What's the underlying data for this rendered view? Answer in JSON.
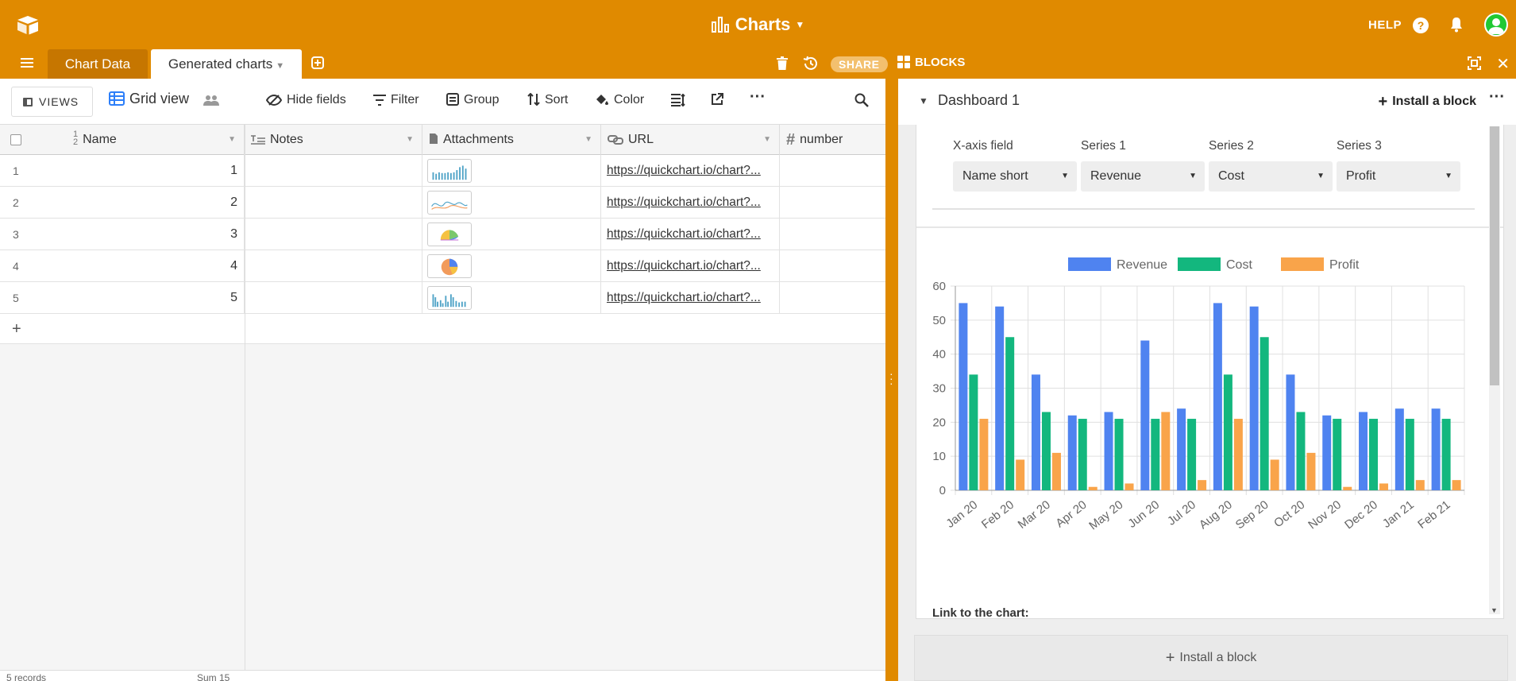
{
  "header": {
    "base_name": "Charts",
    "help_label": "HELP",
    "share_label": "SHARE",
    "blocks_label": "BLOCKS",
    "colors": {
      "bar": "#e08a00",
      "active_tab": "#c67600"
    }
  },
  "tabs": [
    {
      "label": "Chart Data"
    },
    {
      "label": "Generated charts"
    }
  ],
  "toolbar": {
    "views_label": "VIEWS",
    "view_name": "Grid view",
    "hide_fields": "Hide fields",
    "filter": "Filter",
    "group": "Group",
    "sort": "Sort",
    "color": "Color"
  },
  "table": {
    "columns": [
      "Name",
      "Notes",
      "Attachments",
      "URL",
      "number"
    ],
    "rows": [
      {
        "index": "1",
        "name": "1",
        "url": "https://quickchart.io/chart?..."
      },
      {
        "index": "2",
        "name": "2",
        "url": "https://quickchart.io/chart?..."
      },
      {
        "index": "3",
        "name": "3",
        "url": "https://quickchart.io/chart?..."
      },
      {
        "index": "4",
        "name": "4",
        "url": "https://quickchart.io/chart?..."
      },
      {
        "index": "5",
        "name": "5",
        "url": "https://quickchart.io/chart?..."
      }
    ],
    "add_row": "+",
    "footer_count": "5 records",
    "footer_sum": "Sum 15"
  },
  "dashboard": {
    "title": "Dashboard 1",
    "install_block": "Install a block",
    "install_block_bottom": "Install a block",
    "fields": [
      {
        "label": "X-axis field",
        "value": "Name short"
      },
      {
        "label": "Series 1",
        "value": "Revenue"
      },
      {
        "label": "Series 2",
        "value": "Cost"
      },
      {
        "label": "Series 3",
        "value": "Profit"
      }
    ],
    "link_label": "Link to the chart:"
  },
  "chart_data": {
    "type": "bar",
    "categories": [
      "Jan 20",
      "Feb 20",
      "Mar 20",
      "Apr 20",
      "May 20",
      "Jun 20",
      "Jul 20",
      "Aug 20",
      "Sep 20",
      "Oct 20",
      "Nov 20",
      "Dec 20",
      "Jan 21",
      "Feb 21"
    ],
    "series": [
      {
        "name": "Revenue",
        "color": "#4f83f0",
        "values": [
          55,
          54,
          34,
          22,
          23,
          44,
          24,
          55,
          54,
          34,
          22,
          23,
          24,
          24
        ]
      },
      {
        "name": "Cost",
        "color": "#13b77e",
        "values": [
          34,
          45,
          23,
          21,
          21,
          21,
          21,
          34,
          45,
          23,
          21,
          21,
          21,
          21
        ]
      },
      {
        "name": "Profit",
        "color": "#f9a44a",
        "values": [
          21,
          9,
          11,
          1,
          2,
          23,
          3,
          21,
          9,
          11,
          1,
          2,
          3,
          3
        ]
      }
    ],
    "ylim": [
      0,
      60
    ],
    "yticks": [
      "0",
      "10",
      "20",
      "30",
      "40",
      "50",
      "60"
    ],
    "grid": true,
    "legend": "top"
  }
}
